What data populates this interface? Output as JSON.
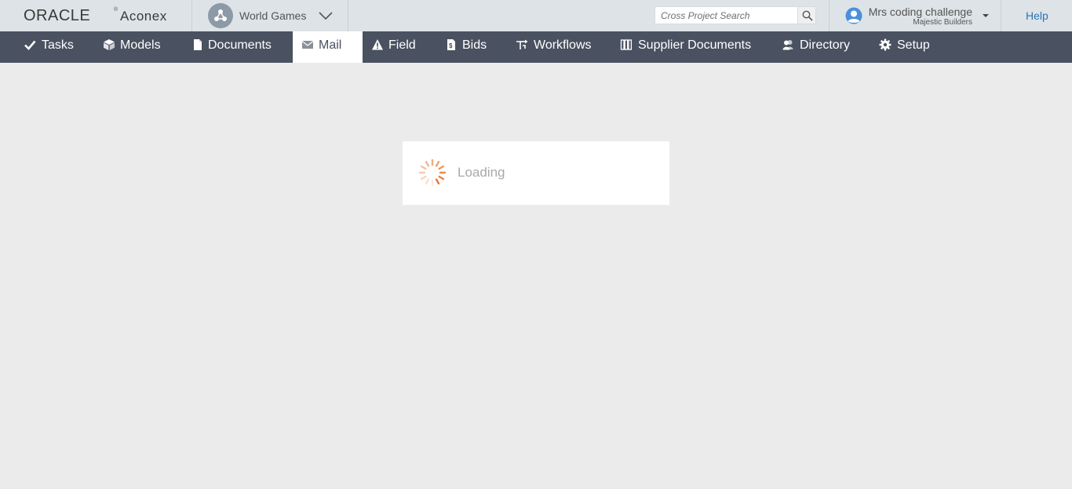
{
  "header": {
    "logo_oracle": "ORACLE",
    "logo_registered": "®",
    "logo_aconex": "Aconex",
    "project_name": "World Games",
    "search_placeholder": "Cross Project Search",
    "user_name": "Mrs coding challenge",
    "user_org": "Majestic Builders",
    "help_label": "Help"
  },
  "nav": {
    "items": [
      {
        "label": "Tasks",
        "icon": "check-icon"
      },
      {
        "label": "Models",
        "icon": "cube-icon"
      },
      {
        "label": "Documents",
        "icon": "document-icon"
      },
      {
        "label": "Mail",
        "icon": "envelope-icon",
        "active": true
      },
      {
        "label": "Field",
        "icon": "warning-icon"
      },
      {
        "label": "Bids",
        "icon": "bid-document-icon"
      },
      {
        "label": "Workflows",
        "icon": "workflow-icon"
      },
      {
        "label": "Supplier Documents",
        "icon": "binders-icon"
      },
      {
        "label": "Directory",
        "icon": "people-icon"
      },
      {
        "label": "Setup",
        "icon": "gear-icon"
      }
    ]
  },
  "main": {
    "loading_text": "Loading"
  },
  "colors": {
    "nav_bg": "#4a5160",
    "header_bg": "#dde3e6",
    "page_bg": "#ebebeb",
    "accent_link": "#2a75b8",
    "spinner": "#e8772e"
  }
}
